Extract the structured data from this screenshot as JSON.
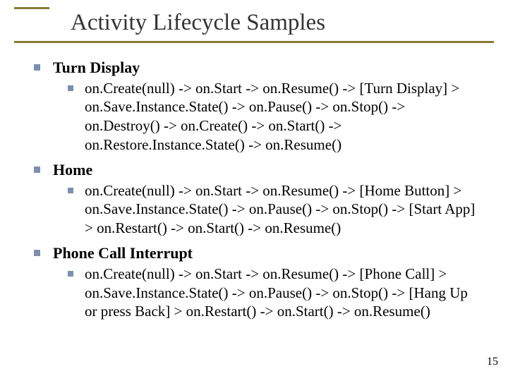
{
  "title": "Activity Lifecycle Samples",
  "items": [
    {
      "heading": "Turn Display",
      "detail": "on.Create(null) -> on.Start -> on.Resume() ->  [Turn Display] > on.Save.Instance.State() -> on.Pause() -> on.Stop() -> on.Destroy()     -> on.Create() -> on.Start() -> on.Restore.Instance.State() -> on.Resume()"
    },
    {
      "heading": "Home",
      "detail": "on.Create(null) -> on.Start -> on.Resume() ->  [Home Button] > on.Save.Instance.State() -> on.Pause() -> on.Stop() ->  [Start App] > on.Restart() -> on.Start() -> on.Resume()"
    },
    {
      "heading": "Phone Call Interrupt",
      "detail": "on.Create(null) -> on.Start -> on.Resume() ->  [Phone Call] > on.Save.Instance.State() -> on.Pause() -> on.Stop() ->  [Hang Up or press Back] > on.Restart() -> on.Start() -> on.Resume()"
    }
  ],
  "page_number": "15"
}
